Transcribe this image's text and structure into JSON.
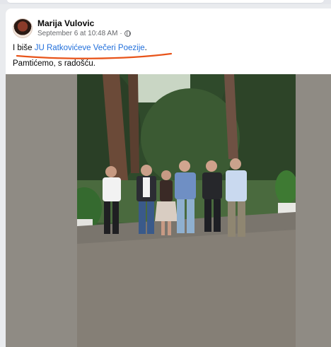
{
  "post": {
    "author": "Marija Vulovic",
    "timestamp": "September 6 at 10:48 AM",
    "separator": "·",
    "text_prefix": "I biše ",
    "text_link": "JU Ratkovićeve Večeri Poezije",
    "text_suffix": ".",
    "text_line2": "Pamtićemo, s radošću."
  },
  "icons": {
    "privacy": "globe-icon",
    "avatar": "profile-avatar"
  },
  "colors": {
    "link": "#216fdb",
    "annotation": "#e8541a",
    "photo_background": "#8f8b84"
  }
}
